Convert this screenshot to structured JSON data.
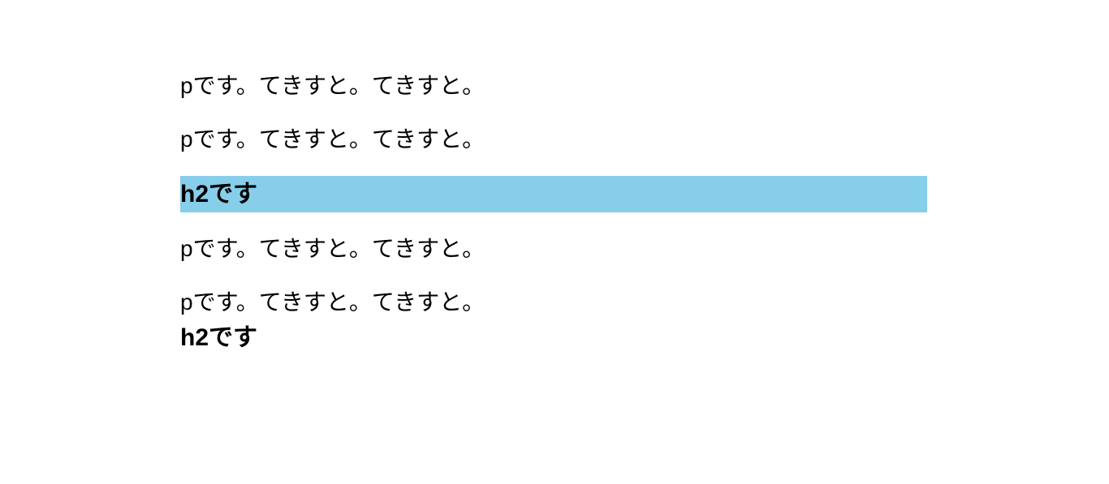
{
  "colors": {
    "highlight": "#87ceeb"
  },
  "content": {
    "lines": [
      {
        "type": "p",
        "text": "pです。てきすと。てきすと。",
        "highlighted": false
      },
      {
        "type": "p",
        "text": "pです。てきすと。てきすと。",
        "highlighted": false
      },
      {
        "type": "h2",
        "text": "h2です",
        "highlighted": true
      },
      {
        "type": "p",
        "text": "pです。てきすと。てきすと。",
        "highlighted": false
      },
      {
        "type": "p",
        "text": "pです。てきすと。てきすと。",
        "highlighted": false
      },
      {
        "type": "h2",
        "text": "h2です",
        "highlighted": false
      }
    ]
  }
}
